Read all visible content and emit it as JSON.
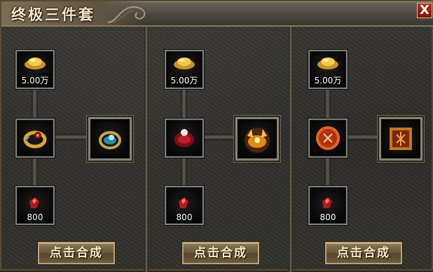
{
  "window": {
    "title": "终极三件套",
    "close_label": "X"
  },
  "panels": [
    {
      "gold_cost": "5.00万",
      "gem_cost": "800",
      "button_label": "点击合成",
      "source_icon": "gold-ring-icon",
      "result_icon": "teal-ring-icon"
    },
    {
      "gold_cost": "5.00万",
      "gem_cost": "800",
      "button_label": "点击合成",
      "source_icon": "red-ring-icon",
      "result_icon": "golden-horned-ring-icon"
    },
    {
      "gold_cost": "5.00万",
      "gem_cost": "800",
      "button_label": "点击合成",
      "source_icon": "soul-orb-icon",
      "result_icon": "sealed-scroll-icon"
    }
  ],
  "colors": {
    "accent_gold": "#d9a734",
    "close_red": "#c22a1d",
    "button_text": "#fbe9c0"
  }
}
